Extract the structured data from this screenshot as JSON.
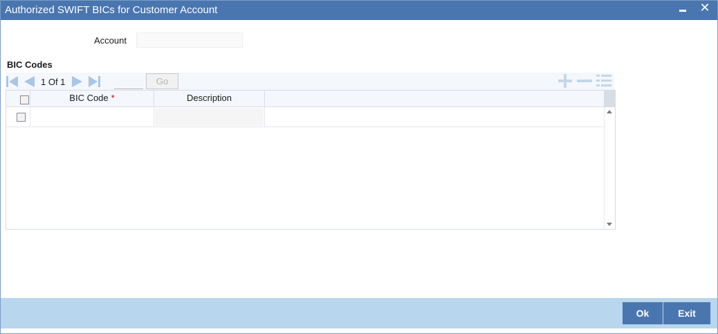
{
  "window": {
    "title": "Authorized SWIFT BICs for Customer Account",
    "minimize_icon": "minimize-icon",
    "close_icon": "close-icon",
    "close_glyph": "✕"
  },
  "form": {
    "account_label": "Account",
    "account_value": ""
  },
  "bic_section": {
    "title": "BIC Codes",
    "pager": {
      "text": "1 Of 1",
      "page_value": "",
      "go_label": "Go"
    },
    "toolbar_icons": [
      "add-row-icon",
      "delete-row-icon",
      "single-record-view-icon"
    ],
    "columns": [
      {
        "label": "BIC Code",
        "required_mark": "*"
      },
      {
        "label": "Description"
      }
    ],
    "rows": [
      {
        "bic_code": "",
        "description": ""
      }
    ]
  },
  "footer": {
    "ok_label": "Ok",
    "exit_label": "Exit"
  },
  "colors": {
    "titlebar": "#4a76b0",
    "footer": "#b8d6ed",
    "button": "#4a76b0",
    "nav_icon": "#a9c6e6",
    "toolbar_icon": "#c5d6ea",
    "required": "#c00000"
  }
}
